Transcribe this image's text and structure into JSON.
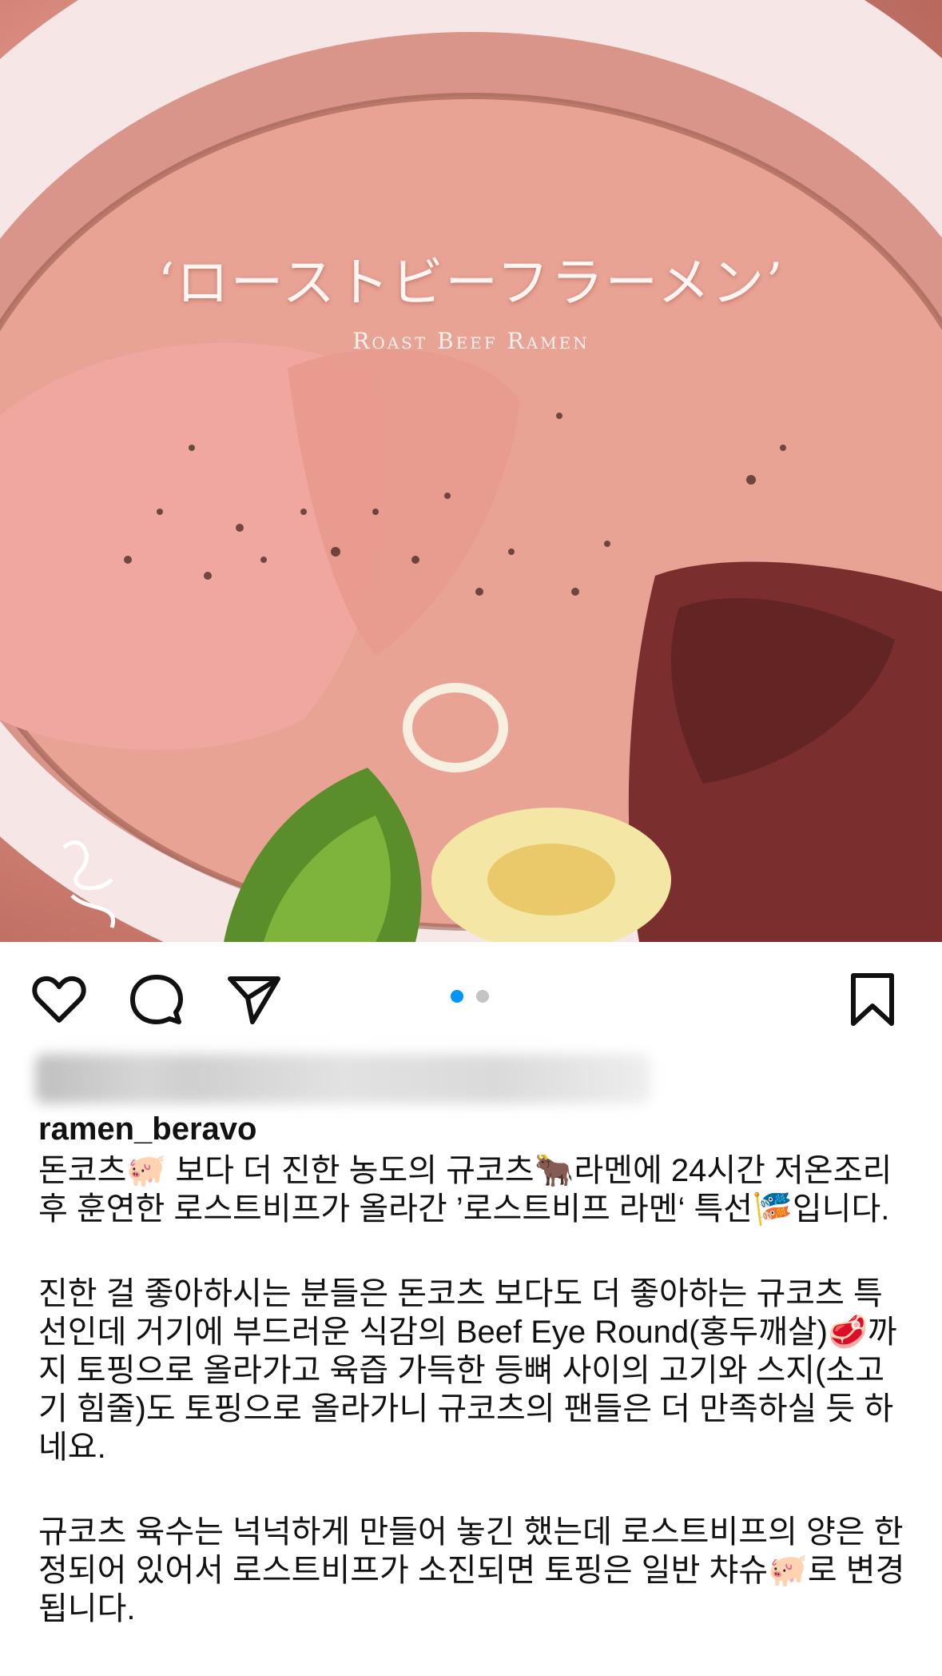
{
  "photo": {
    "title": "‘ローストビーフラーメン’",
    "subtitle": "Roast Beef Ramen"
  },
  "actions": {
    "like_icon": "heart-icon",
    "comment_icon": "comment-bubble-icon",
    "share_icon": "paper-plane-icon",
    "save_icon": "bookmark-icon",
    "carousel_total": 2,
    "carousel_active": 1,
    "active_dot_color": "#0095f6",
    "inactive_dot_color": "#c4c4c4"
  },
  "post": {
    "username": "ramen_beravo",
    "caption_paragraphs": [
      "돈코츠🐖 보다 더 진한 농도의 규코츠🐂라멘에 24시간 저온조리 후 훈연한 로스트비프가 올라간 ’로스트비프 라멘‘ 특선🎏입니다.",
      "진한 걸 좋아하시는 분들은 돈코츠 보다도 더 좋아하는 규코츠 특선인데 거기에 부드러운 식감의 Beef Eye Round(홍두깨살)🥩까지 토핑으로 올라가고 육즙 가득한 등뼈 사이의 고기와 스지(소고기 힘줄)도 토핑으로 올라가니 규코츠의 팬들은 더 만족하실 듯 하네요.",
      "규코츠 육수는 넉넉하게 만들어 놓긴 했는데 로스트비프의 양은 한정되어 있어서 로스트비프가 소진되면 토핑은 일반 챠슈🐖로 변경됩니다."
    ]
  }
}
